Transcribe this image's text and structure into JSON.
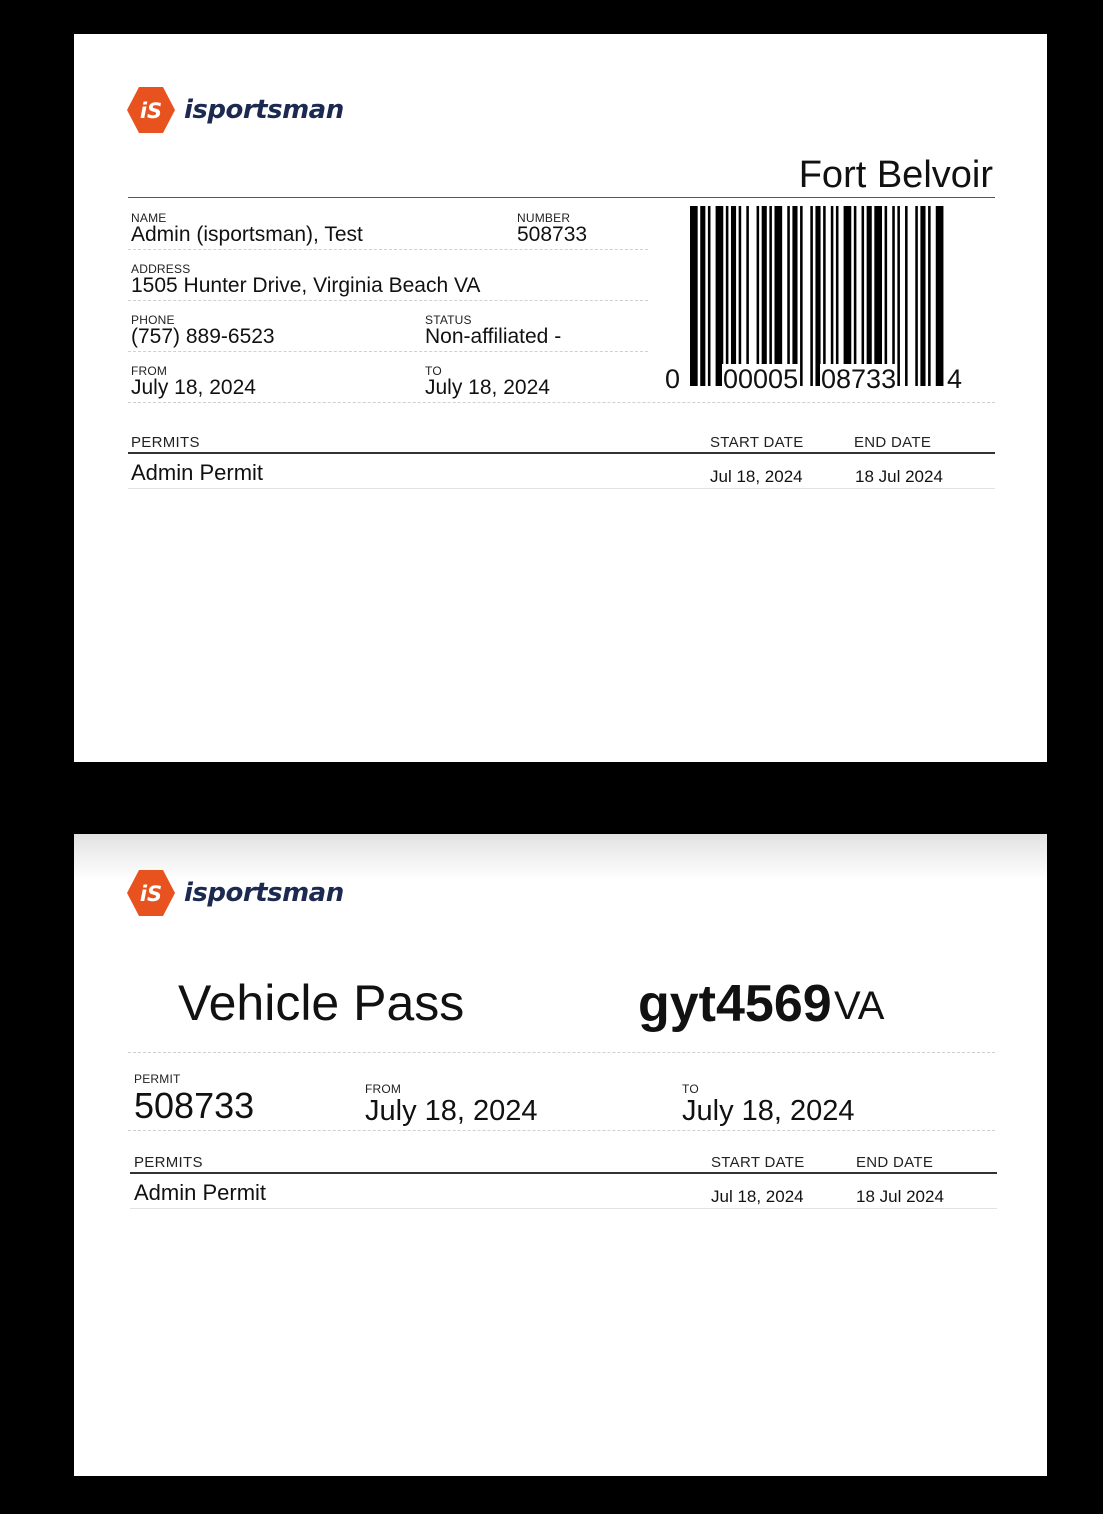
{
  "brand": {
    "name": "isportsman",
    "logo_mark": "iS",
    "logo_color": "#e8521f",
    "text_color": "#1c2a52"
  },
  "license_card": {
    "site": "Fort Belvoir",
    "name_label": "NAME",
    "name": "Admin (isportsman), Test",
    "number_label": "NUMBER",
    "number": "508733",
    "address_label": "ADDRESS",
    "address": "1505 Hunter Drive, Virginia Beach VA",
    "phone_label": "PHONE",
    "phone": "(757) 889-6523",
    "status_label": "STATUS",
    "status": "Non-affiliated -",
    "from_label": "FROM",
    "from": "July 18, 2024",
    "to_label": "TO",
    "to": "July 18, 2024",
    "barcode": {
      "lead": "0",
      "left_group": "00005",
      "right_group": "08733",
      "check": "4"
    },
    "permits_table": {
      "headers": {
        "permits": "PERMITS",
        "start": "START DATE",
        "end": "END DATE"
      },
      "rows": [
        {
          "permit": "Admin Permit",
          "start": "Jul 18, 2024",
          "end": "18 Jul 2024"
        }
      ]
    }
  },
  "vehicle_card": {
    "title": "Vehicle Pass",
    "plate": "gyt4569",
    "state": "VA",
    "permit_label": "PERMIT",
    "permit": "508733",
    "from_label": "FROM",
    "from": "July 18, 2024",
    "to_label": "TO",
    "to": "July 18, 2024",
    "permits_table": {
      "headers": {
        "permits": "PERMITS",
        "start": "START DATE",
        "end": "END DATE"
      },
      "rows": [
        {
          "permit": "Admin Permit",
          "start": "Jul 18, 2024",
          "end": "18 Jul 2024"
        }
      ]
    }
  }
}
